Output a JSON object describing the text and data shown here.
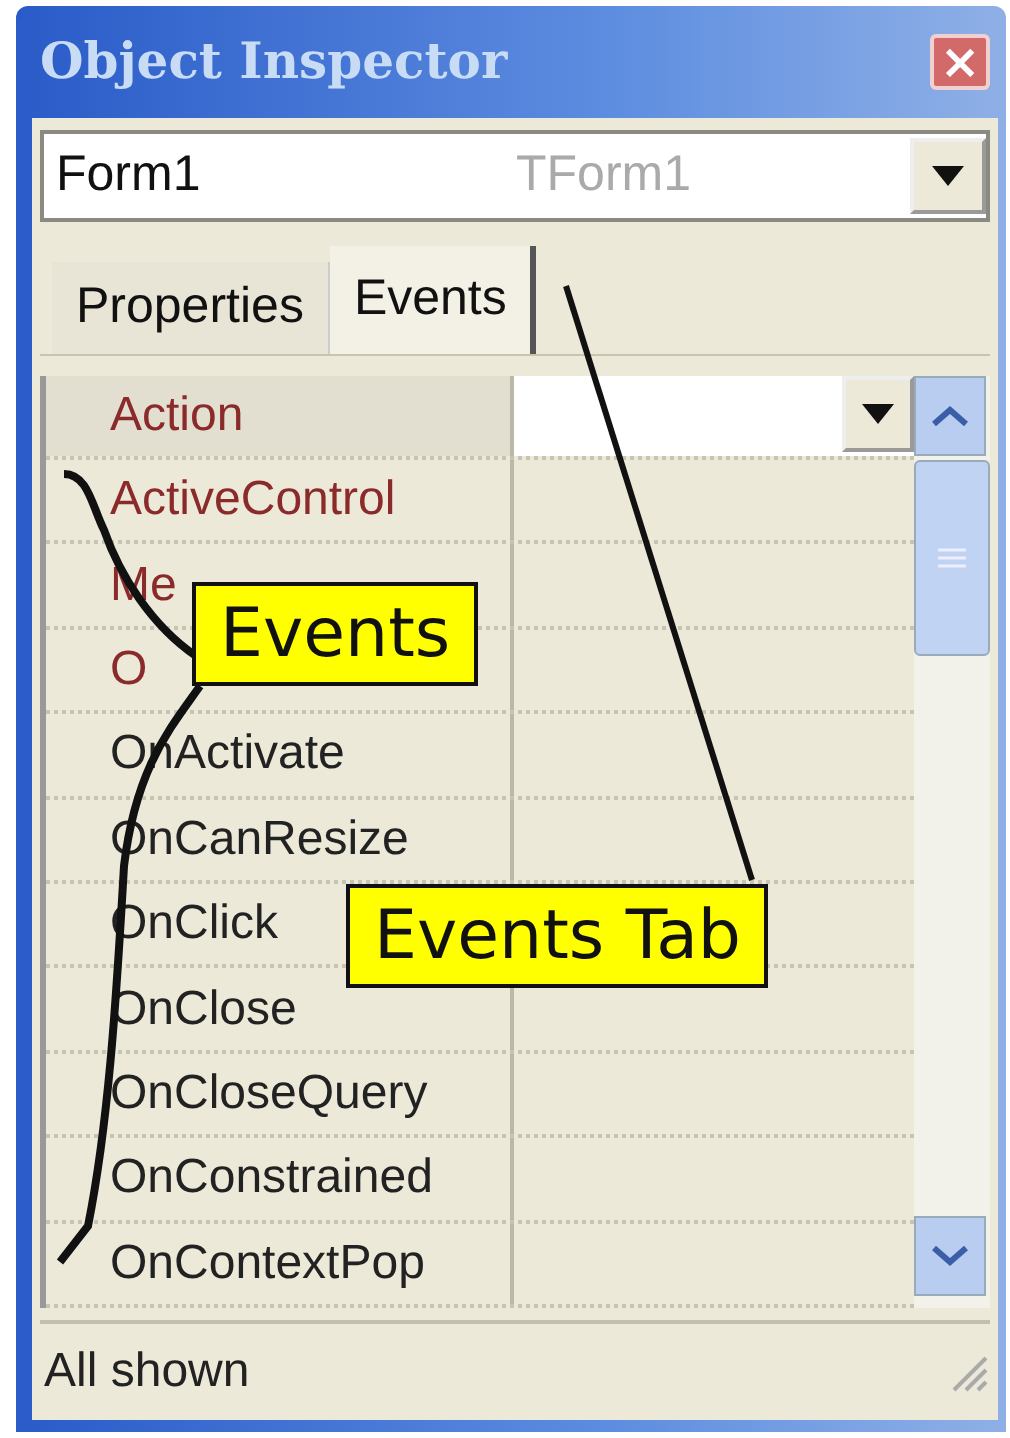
{
  "window": {
    "title": "Object Inspector",
    "close": "×"
  },
  "selector": {
    "name": "Form1",
    "type": "TForm1"
  },
  "tabs": [
    {
      "label": "Properties",
      "selected": false
    },
    {
      "label": "Events",
      "selected": true
    }
  ],
  "rows": [
    {
      "name": "Action",
      "linked": true,
      "selected": true
    },
    {
      "name": "ActiveControl",
      "linked": true,
      "selected": false
    },
    {
      "name": "Me",
      "linked": true,
      "selected": false
    },
    {
      "name": "O",
      "linked": true,
      "selected": false
    },
    {
      "name": "OnActivate",
      "linked": false,
      "selected": false
    },
    {
      "name": "OnCanResize",
      "linked": false,
      "selected": false
    },
    {
      "name": "OnClick",
      "linked": false,
      "selected": false
    },
    {
      "name": "OnClose",
      "linked": false,
      "selected": false
    },
    {
      "name": "OnCloseQuery",
      "linked": false,
      "selected": false
    },
    {
      "name": "OnConstrained",
      "linked": false,
      "selected": false
    },
    {
      "name": "OnContextPop",
      "linked": false,
      "selected": false
    }
  ],
  "status_bar": "All shown",
  "callouts": [
    {
      "text": "Events"
    },
    {
      "text": "Events Tab"
    }
  ]
}
